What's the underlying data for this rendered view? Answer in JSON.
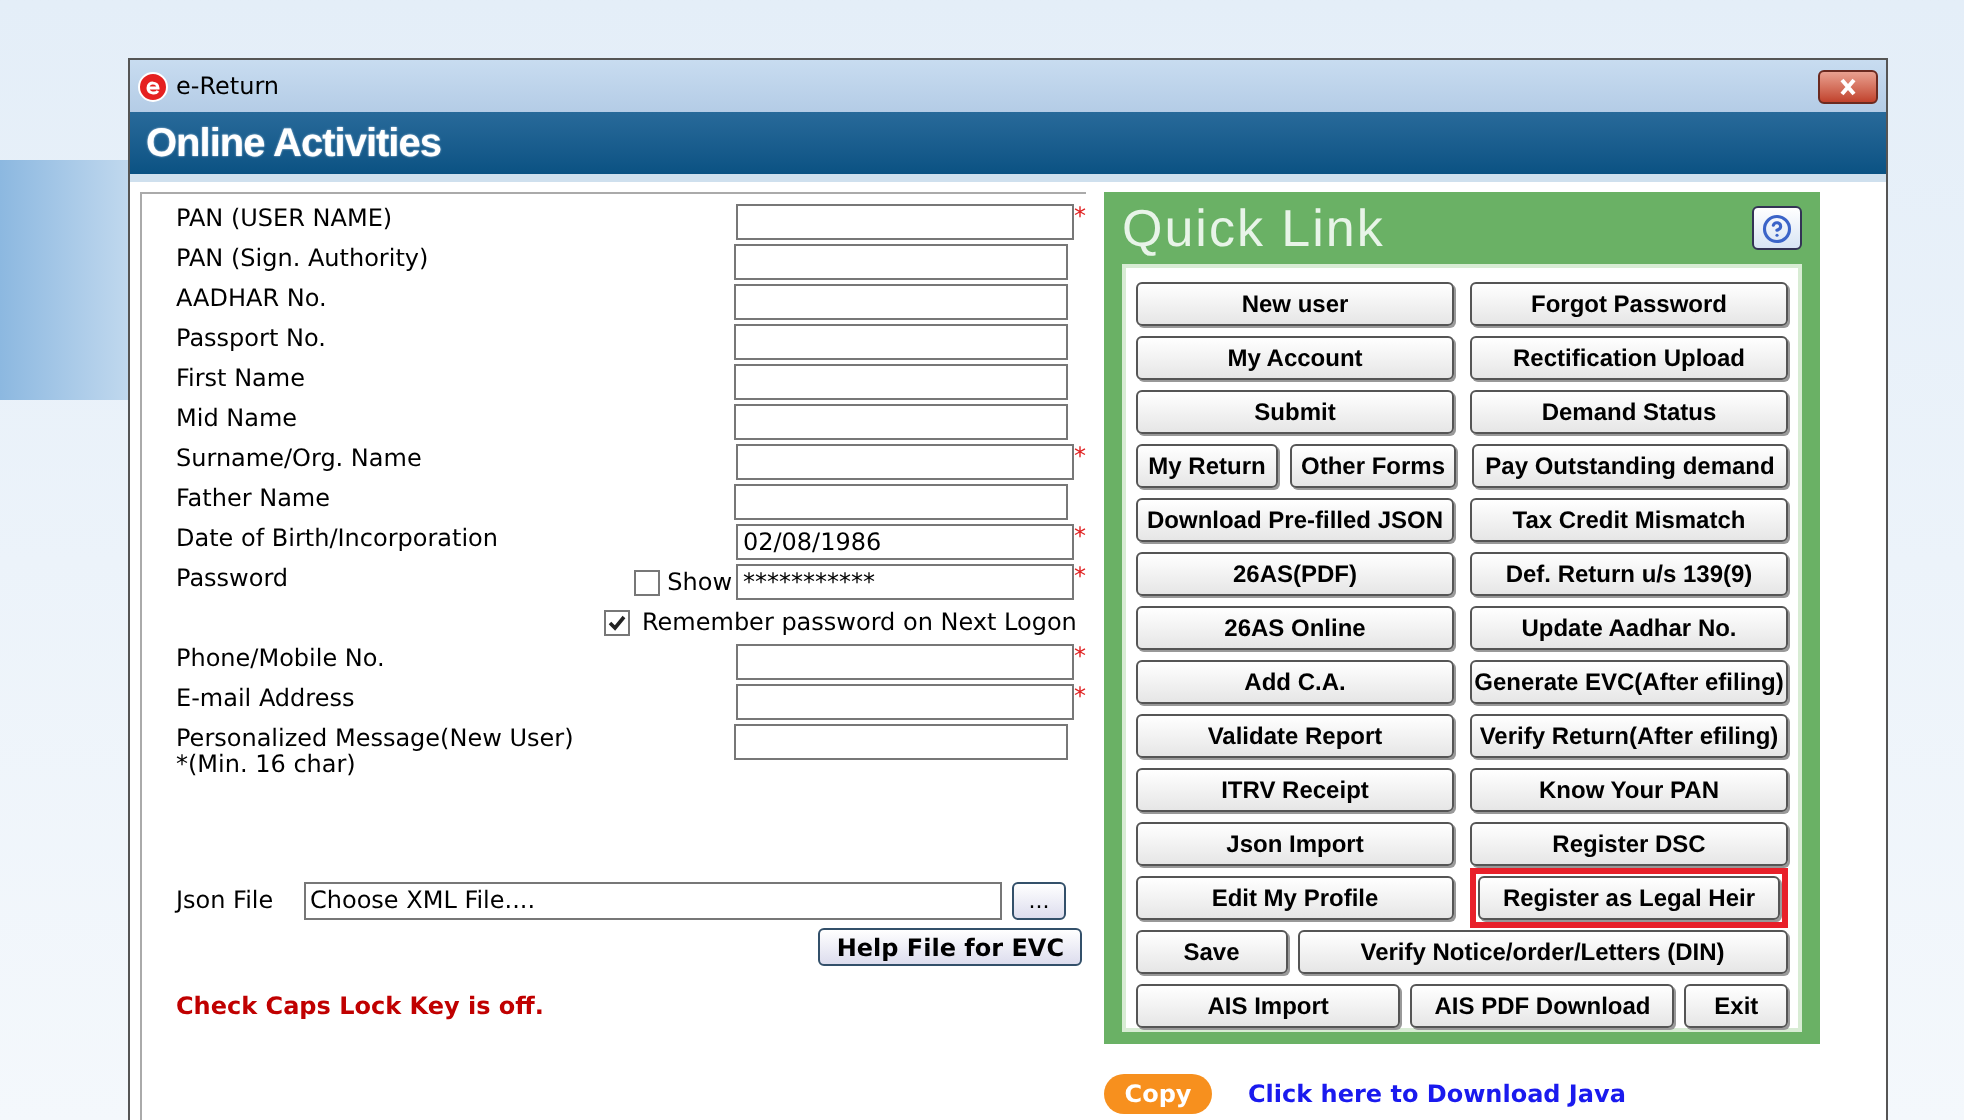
{
  "window": {
    "title": "e-Return"
  },
  "header": {
    "title": "Online Activities"
  },
  "form": {
    "required_mark": "*",
    "fields": [
      {
        "label": "PAN (USER NAME)",
        "kind": "text",
        "required": true
      },
      {
        "label": "PAN (Sign. Authority)",
        "kind": "text",
        "required": false
      },
      {
        "label": "AADHAR No.",
        "kind": "text",
        "required": false
      },
      {
        "label": "Passport No.",
        "kind": "text",
        "required": false
      },
      {
        "label": "First Name",
        "kind": "text",
        "required": false
      },
      {
        "label": "Mid Name",
        "kind": "text",
        "required": false
      },
      {
        "label": "Surname/Org. Name",
        "kind": "text",
        "required": true
      },
      {
        "label": "Father Name",
        "kind": "text",
        "required": false
      },
      {
        "label": "Date of Birth/Incorporation",
        "kind": "text",
        "value": "02/08/1986",
        "required": true
      },
      {
        "label": "Password",
        "kind": "password",
        "value": "***********",
        "required": true,
        "show": {
          "label": "Show",
          "checked": false
        }
      },
      {
        "label": "Remember password on Next Logon",
        "kind": "checkbox",
        "checked": true
      },
      {
        "label": "Phone/Mobile No.",
        "kind": "text",
        "required": true
      },
      {
        "label": "E-mail Address",
        "kind": "text",
        "required": true
      },
      {
        "label": "Personalized Message(New User)",
        "note": "*(Min. 16 char)",
        "kind": "text",
        "required": false
      }
    ],
    "json_file": {
      "label": "Json File",
      "value": "Choose XML File....",
      "browse": "..."
    },
    "help_button": "Help File for EVC",
    "warning": "Check Caps Lock Key is off."
  },
  "quick_link": {
    "title": "Quick Link",
    "rows": [
      {
        "kind": "pair",
        "buttons": [
          {
            "label": "New user",
            "highlighted": false
          },
          {
            "label": "Forgot Password",
            "highlighted": false
          }
        ]
      },
      {
        "kind": "pair",
        "buttons": [
          {
            "label": "My Account",
            "highlighted": false
          },
          {
            "label": "Rectification Upload",
            "highlighted": false
          }
        ]
      },
      {
        "kind": "pair",
        "buttons": [
          {
            "label": "Submit",
            "highlighted": false
          },
          {
            "label": "Demand Status",
            "highlighted": false
          }
        ]
      },
      {
        "kind": "split",
        "buttons": [
          {
            "label": "My Return",
            "highlighted": false
          },
          {
            "label": "Other Forms",
            "highlighted": false
          },
          {
            "label": "Pay Outstanding demand",
            "highlighted": false
          }
        ]
      },
      {
        "kind": "pair",
        "buttons": [
          {
            "label": "Download Pre-filled JSON",
            "highlighted": false
          },
          {
            "label": "Tax Credit Mismatch",
            "highlighted": false
          }
        ]
      },
      {
        "kind": "pair",
        "buttons": [
          {
            "label": "26AS(PDF)",
            "highlighted": false
          },
          {
            "label": "Def. Return u/s 139(9)",
            "highlighted": false
          }
        ]
      },
      {
        "kind": "pair",
        "buttons": [
          {
            "label": "26AS Online",
            "highlighted": false
          },
          {
            "label": "Update Aadhar No.",
            "highlighted": false
          }
        ]
      },
      {
        "kind": "pair",
        "buttons": [
          {
            "label": "Add C.A.",
            "highlighted": false
          },
          {
            "label": "Generate EVC(After efiling)",
            "highlighted": false
          }
        ]
      },
      {
        "kind": "pair",
        "buttons": [
          {
            "label": "Validate Report",
            "highlighted": false
          },
          {
            "label": "Verify Return(After efiling)",
            "highlighted": false
          }
        ]
      },
      {
        "kind": "pair",
        "buttons": [
          {
            "label": "ITRV Receipt",
            "highlighted": false
          },
          {
            "label": "Know Your PAN",
            "highlighted": false
          }
        ]
      },
      {
        "kind": "pair",
        "buttons": [
          {
            "label": "Json Import",
            "highlighted": false
          },
          {
            "label": "Register DSC",
            "highlighted": false
          }
        ]
      },
      {
        "kind": "pair",
        "buttons": [
          {
            "label": "Edit My Profile",
            "highlighted": false
          },
          {
            "label": "Register as Legal Heir",
            "highlighted": true
          }
        ]
      },
      {
        "kind": "wide",
        "buttons": [
          {
            "label": "Save",
            "highlighted": false
          },
          {
            "label": "Verify Notice/order/Letters (DIN)",
            "highlighted": false
          }
        ]
      },
      {
        "kind": "triple",
        "buttons": [
          {
            "label": "AIS Import",
            "highlighted": false
          },
          {
            "label": "AIS PDF Download",
            "highlighted": false
          },
          {
            "label": "Exit",
            "highlighted": false
          }
        ]
      }
    ]
  },
  "footer": {
    "copy_button": "Copy",
    "java_link": "Click here to Download Java"
  }
}
